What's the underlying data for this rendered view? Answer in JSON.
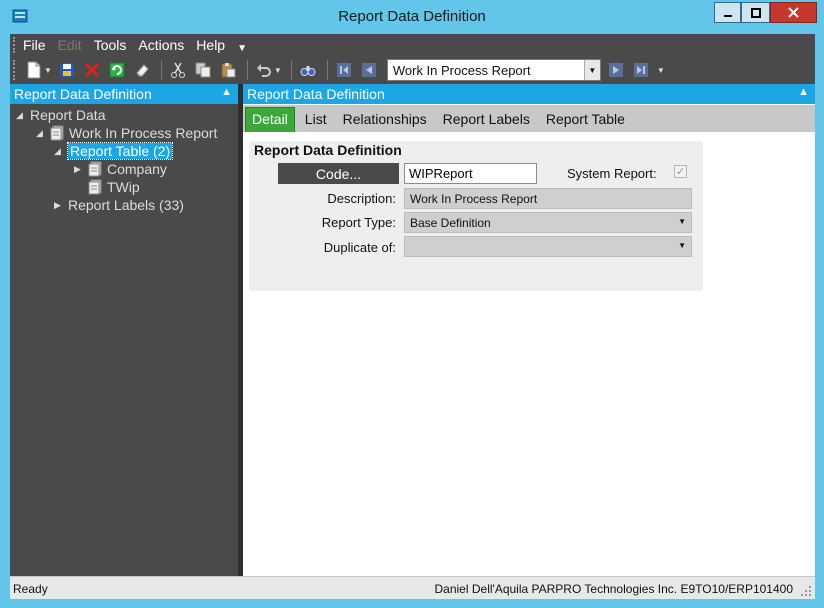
{
  "window": {
    "title": "Report Data Definition",
    "icons": {
      "app": "app-icon",
      "minimize": "minimize-icon",
      "maximize": "maximize-icon",
      "close": "close-icon"
    }
  },
  "menu": {
    "items": [
      {
        "label": "File",
        "enabled": true
      },
      {
        "label": "Edit",
        "enabled": false
      },
      {
        "label": "Tools",
        "enabled": true
      },
      {
        "label": "Actions",
        "enabled": true
      },
      {
        "label": "Help",
        "enabled": true
      }
    ]
  },
  "toolbar": {
    "icons": [
      "new-icon",
      "save-icon",
      "delete-icon",
      "refresh-icon",
      "clear-icon",
      "cut-icon",
      "copy-icon",
      "paste-icon",
      "undo-icon",
      "search-icon",
      "first-record-icon",
      "previous-record-icon",
      "next-record-icon",
      "last-record-icon"
    ],
    "navigation_value": "Work In Process Report"
  },
  "left_pane": {
    "header": "Report Data Definition",
    "tree": {
      "root": "Report Data",
      "report": "Work In Process Report",
      "report_table": "Report Table (2)",
      "company": "Company",
      "twip": "TWip",
      "report_labels": "Report Labels (33)"
    }
  },
  "right_pane": {
    "header": "Report Data Definition",
    "tabs": [
      "Detail",
      "List",
      "Relationships",
      "Report Labels",
      "Report Table"
    ],
    "active_tab": "Detail",
    "form": {
      "title": "Report Data Definition",
      "code_button": "Code...",
      "code_value": "WIPReport",
      "system_report_label": "System Report:",
      "system_report_checked": true,
      "description_label": "Description:",
      "description_value": "Work In Process Report",
      "report_type_label": "Report Type:",
      "report_type_value": "Base Definition",
      "duplicate_of_label": "Duplicate of:",
      "duplicate_of_value": ""
    }
  },
  "status": {
    "left": "Ready",
    "right": "Daniel Dell'Aquila  PARPRO Technologies Inc.  E9TO10/ERP101400"
  },
  "colors": {
    "title_bar": "#62c6ea",
    "pane_header": "#1da6e6",
    "dark_panel": "#4a4a4a",
    "active_tab": "#3aa93a",
    "close_button": "#c7362a"
  }
}
